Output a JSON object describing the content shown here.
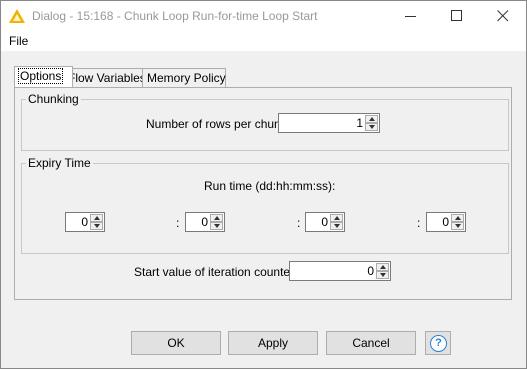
{
  "window": {
    "title": "Dialog - 15:168 - Chunk Loop Run-for-time Loop Start",
    "controls": {
      "minimize": "minimize-icon",
      "maximize": "maximize-icon",
      "close": "close-icon"
    },
    "app_icon": "knime-warning-triangle-icon"
  },
  "menu": {
    "file": "File"
  },
  "tabs": [
    {
      "label": "Options",
      "active": true
    },
    {
      "label": "Flow Variables",
      "active": false
    },
    {
      "label": "Memory Policy",
      "active": false
    }
  ],
  "chunking": {
    "legend": "Chunking",
    "rows_label": "Number of rows per chunk",
    "rows_value": "1"
  },
  "expiry": {
    "legend": "Expiry Time",
    "run_time_label": "Run time (dd:hh:mm:ss):",
    "separator": ":",
    "days": "0",
    "hours": "0",
    "minutes": "0",
    "seconds": "0"
  },
  "iteration": {
    "label": "Start value of iteration counter",
    "value": "0"
  },
  "buttons": {
    "ok": "OK",
    "apply": "Apply",
    "cancel": "Cancel",
    "help": "?"
  },
  "colors": {
    "accent": "#2a7fd4",
    "app_icon": "#f0b400"
  }
}
